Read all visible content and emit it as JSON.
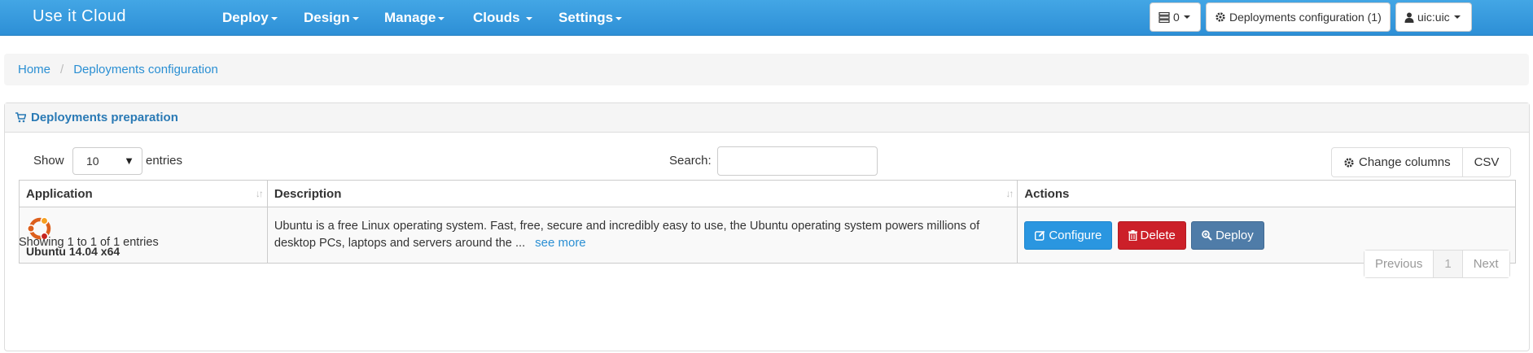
{
  "navbar": {
    "brand": "Use it Cloud",
    "menu": [
      {
        "label": "Deploy"
      },
      {
        "label": "Design"
      },
      {
        "label": "Manage"
      },
      {
        "label": "Clouds"
      },
      {
        "label": "Settings"
      }
    ],
    "tasks_count": "0",
    "deployments_config_label": "Deployments configuration (1)",
    "user_label": "uic:uic"
  },
  "breadcrumb": {
    "home": "Home",
    "current": "Deployments configuration"
  },
  "panel": {
    "title": "Deployments preparation",
    "show_label": "Show",
    "page_size": "10",
    "entries_label": "entries",
    "search_label": "Search:",
    "search_value": "",
    "change_columns_label": "Change columns",
    "csv_label": "CSV"
  },
  "table": {
    "columns": [
      "Application",
      "Description",
      "Actions"
    ],
    "rows": [
      {
        "application": "Ubuntu 14.04 x64",
        "description": "Ubuntu is a free Linux operating system. Fast, free, secure and incredibly easy to use, the Ubuntu operating system powers millions of desktop PCs, laptops and servers around the ...",
        "see_more": "see more",
        "actions": {
          "configure": "Configure",
          "delete": "Delete",
          "deploy": "Deploy"
        }
      }
    ]
  },
  "footer": {
    "info": "Showing 1 to 1 of 1 entries",
    "previous": "Previous",
    "page": "1",
    "next": "Next"
  },
  "colors": {
    "navbar": "#2d8fd6",
    "link": "#2a8fd3",
    "configure": "#2a96e0",
    "delete": "#cc2029",
    "deploy": "#4f7ca8"
  },
  "icons": {
    "tasks": "server-list-icon",
    "config": "gear-icon",
    "user": "user-icon",
    "panel": "cart-icon",
    "app": "ubuntu-logo",
    "configure": "edit-icon",
    "delete": "trash-icon",
    "deploy": "zoom-icon"
  }
}
